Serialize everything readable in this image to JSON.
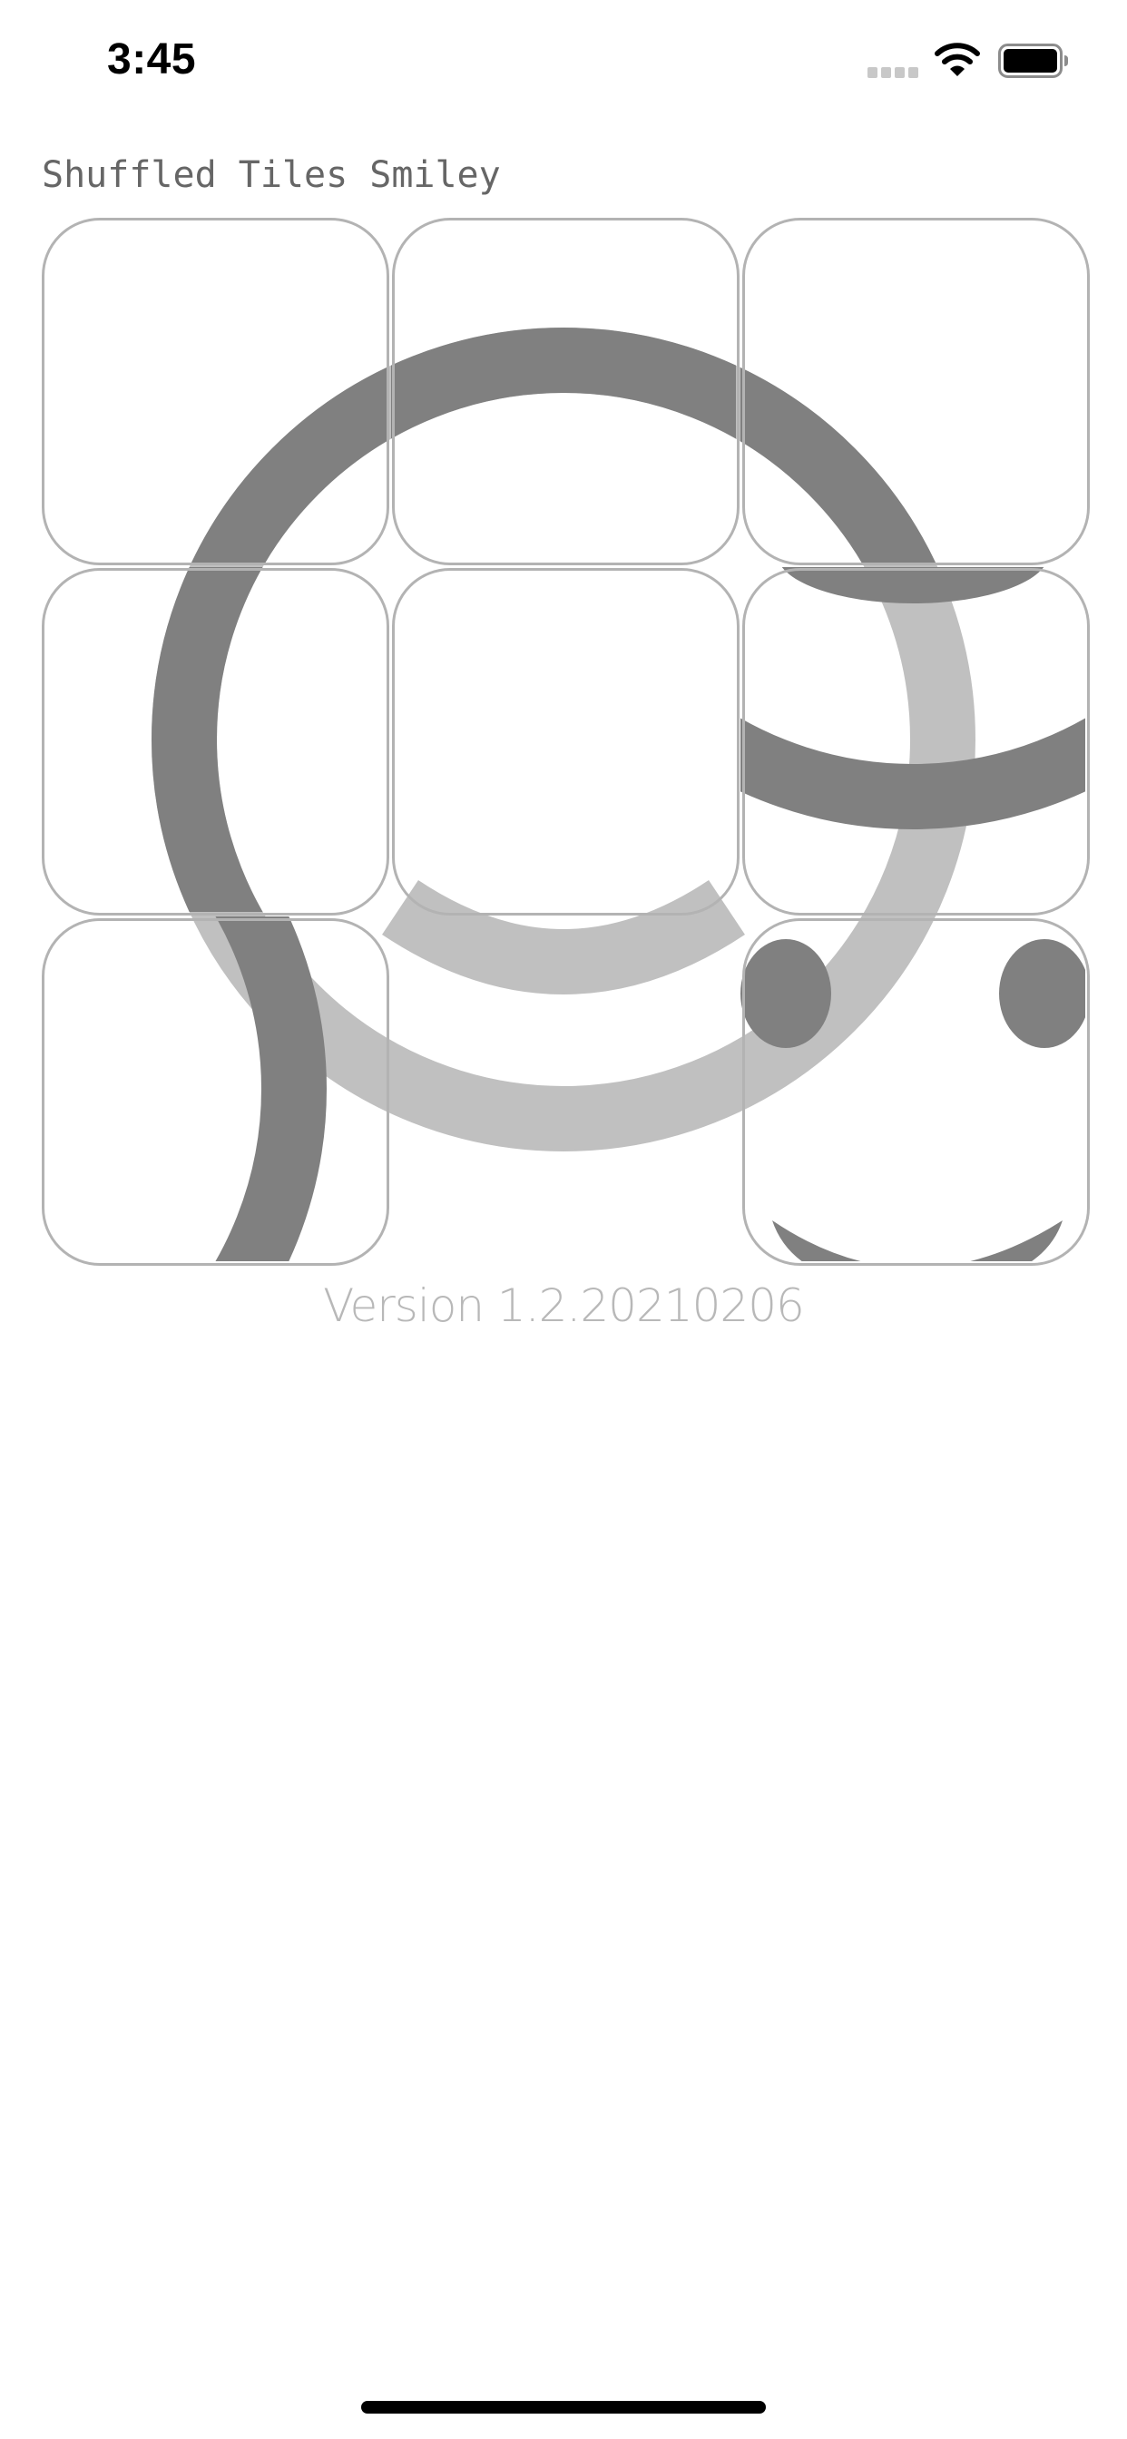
{
  "status_bar": {
    "time": "3:45",
    "signal_icon": "cellular-signal-icon",
    "wifi_icon": "wifi-icon",
    "battery_icon": "battery-full-icon"
  },
  "page": {
    "title": "Shuffled Tiles Smiley",
    "version": "Version 1.2.20210206"
  },
  "puzzle": {
    "rows": 3,
    "cols": 3,
    "tile_count": 8,
    "empty_slot": "row 3, column 2",
    "colors": {
      "stroke": "#808080",
      "ghost": "#c0c0c0",
      "tile_border": "#b3b3b3"
    }
  }
}
